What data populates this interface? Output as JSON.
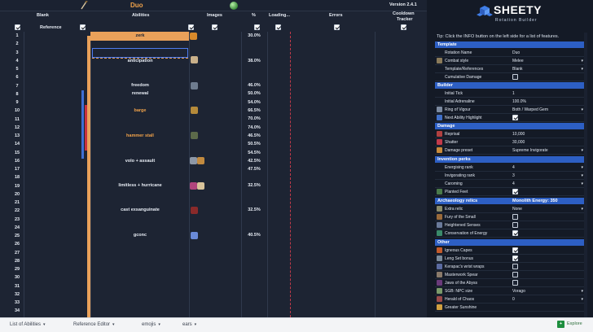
{
  "sheet": {
    "title": "Duo",
    "version": "Version 2.4.1",
    "headers": {
      "blank": "Blank",
      "abilities": "Abilities",
      "images": "Images",
      "pct": "%",
      "loading": "Loading...",
      "errors": "Errors",
      "cooldown1": "Cooldown",
      "cooldown2": "Tracker",
      "reference": "Reference"
    },
    "row_numbers": [
      "1",
      "2",
      "3",
      "4",
      "5",
      "6",
      "7",
      "8",
      "9",
      "10",
      "11",
      "12",
      "13",
      "14",
      "15",
      "16",
      "17",
      "18",
      "19",
      "20",
      "21",
      "22",
      "23",
      "24",
      "25",
      "26",
      "27",
      "28",
      "29",
      "30",
      "31",
      "32",
      "33",
      "34"
    ],
    "abilities": {
      "zerk": "zerk",
      "anticipation": "anticipation",
      "freedom": "freedom",
      "renewal": "renewal",
      "barge": "barge",
      "hammer_stall": "hammer stall",
      "volo_assault": "volo + assault",
      "limitless_hurricane": "limitless + hurricane",
      "cast_exsanguinate": "cast exsanguinate",
      "gconc": "gconc"
    },
    "percents": {
      "r1": "30.0%",
      "r4": "38.0%",
      "r7": "46.0%",
      "r8": "50.0%",
      "r9": "54.0%",
      "r10": "66.5%",
      "r11": "70.0%",
      "r12": "74.0%",
      "r13": "46.5%",
      "r14": "50.5%",
      "r15": "54.5%",
      "r16": "42.5%",
      "r17": "47.5%",
      "r19": "32.5%",
      "r22": "32.5%",
      "r25": "40.5%"
    }
  },
  "tabs": {
    "t1": "List of Abilities",
    "t2": "Reference Editor",
    "t3": "emojis",
    "t4": "ears",
    "explore": "Explore"
  },
  "panel": {
    "logo": "SHEETY",
    "logo_sub": "Rotation Builder",
    "tip": "Tip: Click the INFO button on the left side for a list of features.",
    "sections": {
      "template": "Template",
      "builder": "Builder",
      "damage": "Damage",
      "invention": "Invention perks",
      "archaeology": "Archaeology relics",
      "monolith": "Monolith Energy: 350",
      "other": "Other"
    },
    "rows": {
      "rotation_name": {
        "label": "Rotation Name",
        "value": "Duo"
      },
      "combat_style": {
        "label": "Combat style",
        "value": "Melee"
      },
      "template_refs": {
        "label": "Template/References",
        "value": "Blank"
      },
      "cumulative": {
        "label": "Cumulative Damage"
      },
      "initial_tick": {
        "label": "Initial Tick",
        "value": "1"
      },
      "initial_adren": {
        "label": "Initial Adrenaline",
        "value": "100.0%"
      },
      "ring_vigour": {
        "label": "Ring of Vigour",
        "value": "Both / Warped Gem"
      },
      "next_ability": {
        "label": "Next Ability Highlight"
      },
      "reprisal": {
        "label": "Reprisal",
        "value": "10,000"
      },
      "shatter": {
        "label": "Shatter",
        "value": "30,000"
      },
      "damage_preset": {
        "label": "Damage preset",
        "value": "Supreme Invigorate"
      },
      "energising": {
        "label": "Energising rank",
        "value": "4"
      },
      "invigorating": {
        "label": "Invigorating rank",
        "value": "3"
      },
      "caroming": {
        "label": "Caroming",
        "value": "4"
      },
      "planted": {
        "label": "Planted Feet"
      },
      "extra_relic": {
        "label": "Extra relic",
        "value": "None"
      },
      "fury_small": {
        "label": "Fury of the Small"
      },
      "heightened": {
        "label": "Heightened Senses"
      },
      "conservation": {
        "label": "Conservation of Energy"
      },
      "igneous": {
        "label": "Igneous Capes"
      },
      "leng": {
        "label": "Leng Set bonus"
      },
      "kerapac": {
        "label": "Kerapac's wrist wraps"
      },
      "masterwork": {
        "label": "Masterwork Spear"
      },
      "jaws": {
        "label": "Jaws of the Abyss"
      },
      "sgb": {
        "label": "SGB: NPC size",
        "value": "Vorago"
      },
      "herald": {
        "label": "Herald of Chaos",
        "value": "0"
      },
      "greater_sunshine": {
        "label": "Greater Sunshine"
      }
    }
  },
  "colors": {
    "accent_orange": "#e9a15a",
    "section_blue": "#2d5fc4",
    "selection_blue": "#4d7cf0",
    "error_red": "#c23a4a"
  }
}
